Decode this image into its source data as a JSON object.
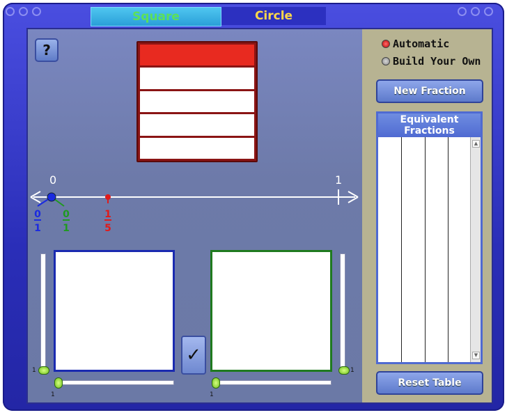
{
  "tabs": {
    "square": "Square",
    "circle": "Circle"
  },
  "help": {
    "label": "?"
  },
  "fraction_bars": {
    "total": 5,
    "filled": 1
  },
  "number_line": {
    "start_label": "0",
    "end_label": "1"
  },
  "fraction_markers": [
    {
      "numerator": "0",
      "denominator": "1",
      "color": "#1a2ae0"
    },
    {
      "numerator": "0",
      "denominator": "1",
      "color": "#1f9a1f"
    },
    {
      "numerator": "1",
      "denominator": "5",
      "color": "#e01a1a"
    }
  ],
  "check_button": {
    "label": "✓"
  },
  "sliders": {
    "left_vertical": "1",
    "left_horizontal": "1",
    "right_vertical": "1",
    "right_horizontal": "1"
  },
  "mode": {
    "automatic": "Automatic",
    "build": "Build Your Own",
    "selected": "automatic"
  },
  "buttons": {
    "new_fraction": "New Fraction",
    "reset_table": "Reset Table"
  },
  "table": {
    "header": "Equivalent Fractions",
    "columns": 4,
    "rows": []
  },
  "colors": {
    "accent": "#4f6ad2",
    "fraction_fill": "#e82a20",
    "left_square": "#1a2ab0",
    "right_square": "#1f7a1f"
  }
}
